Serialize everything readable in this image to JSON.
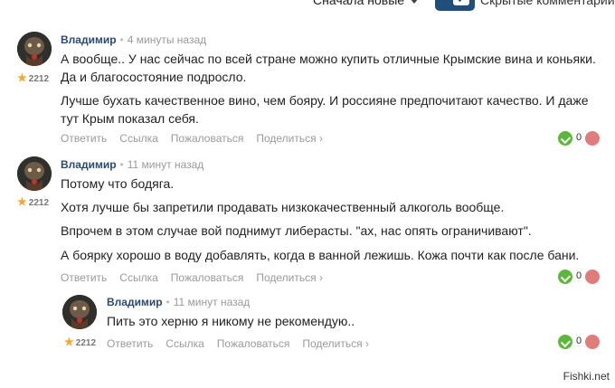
{
  "top": {
    "sort_label": "Сначала новые",
    "hidden_label": "Скрытые комментарии"
  },
  "comments": [
    {
      "author": "Владимир",
      "time": "4 минуты назад",
      "rating": "2212",
      "paragraphs": [
        "А вообще.. У нас сейчас по всей стране можно купить отличные Крымские вина и коньяки. Да и благосостояние подросло.",
        "Лучше бухать качественное вино, чем бояру. И россияне предпочитают качество. И даже тут Крым показал себя."
      ],
      "votes": "0"
    },
    {
      "author": "Владимир",
      "time": "11 минут назад",
      "rating": "2212",
      "paragraphs": [
        "Потому что бодяга.",
        "Хотя лучше бы запретили продавать низкокачественный алкоголь вообще.",
        "Впрочем в этом случае вой поднимут либерасты. \"ах, нас опять ограничивают\".",
        "А боярку хорошо в воду добавлять, когда в ванной лежишь. Кожа почти как после бани."
      ],
      "votes": "0"
    },
    {
      "author": "Владимир",
      "time": "11 минут назад",
      "rating": "2212",
      "paragraphs": [
        "Пить это херню я никому не рекомендую.."
      ],
      "votes": "0"
    }
  ],
  "actions": {
    "reply": "Ответить",
    "link": "Ссылка",
    "report": "Пожаловаться",
    "share": "Поделиться"
  },
  "watermark": "Fishki.net",
  "colors": {
    "accent": "#1f4f7a",
    "vote_up": "#5bb83a",
    "vote_down": "#e07c7c",
    "star": "#f0a830"
  }
}
